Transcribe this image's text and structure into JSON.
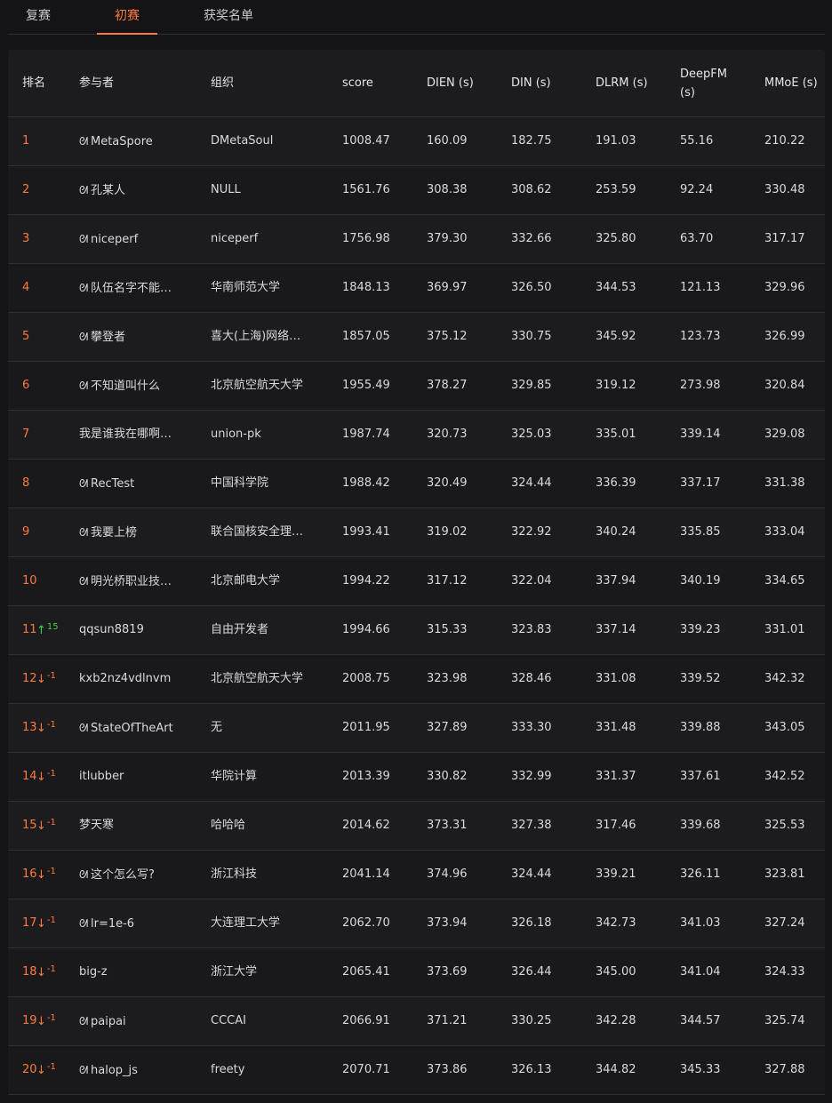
{
  "tabs": [
    {
      "label": "复赛",
      "active": false
    },
    {
      "label": "初赛",
      "active": true
    },
    {
      "label": "获奖名单",
      "active": false
    }
  ],
  "columns": [
    "排名",
    "参与者",
    "组织",
    "score",
    "DIEN (s)",
    "DIN (s)",
    "DLRM (s)",
    "DeepFM (s)",
    "MMoE (s)"
  ],
  "rows": [
    {
      "rank": "1",
      "change": null,
      "participant": "MetaSpore",
      "team": true,
      "org": "DMetaSoul",
      "score": "1008.47",
      "dien": "160.09",
      "din": "182.75",
      "dlrm": "191.03",
      "deepfm": "55.16",
      "mmoe": "210.22"
    },
    {
      "rank": "2",
      "change": null,
      "participant": "孔某人",
      "team": true,
      "org": "NULL",
      "score": "1561.76",
      "dien": "308.38",
      "din": "308.62",
      "dlrm": "253.59",
      "deepfm": "92.24",
      "mmoe": "330.48"
    },
    {
      "rank": "3",
      "change": null,
      "participant": "niceperf",
      "team": true,
      "org": "niceperf",
      "score": "1756.98",
      "dien": "379.30",
      "din": "332.66",
      "dlrm": "325.80",
      "deepfm": "63.70",
      "mmoe": "317.17"
    },
    {
      "rank": "4",
      "change": null,
      "participant": "队伍名字不能…",
      "team": true,
      "org": "华南师范大学",
      "score": "1848.13",
      "dien": "369.97",
      "din": "326.50",
      "dlrm": "344.53",
      "deepfm": "121.13",
      "mmoe": "329.96"
    },
    {
      "rank": "5",
      "change": null,
      "participant": "攀登者",
      "team": true,
      "org": "喜大(上海)网络…",
      "score": "1857.05",
      "dien": "375.12",
      "din": "330.75",
      "dlrm": "345.92",
      "deepfm": "123.73",
      "mmoe": "326.99"
    },
    {
      "rank": "6",
      "change": null,
      "participant": "不知道叫什么",
      "team": true,
      "org": "北京航空航天大学",
      "score": "1955.49",
      "dien": "378.27",
      "din": "329.85",
      "dlrm": "319.12",
      "deepfm": "273.98",
      "mmoe": "320.84"
    },
    {
      "rank": "7",
      "change": null,
      "participant": "我是谁我在哪啊…",
      "team": false,
      "org": "union-pk",
      "score": "1987.74",
      "dien": "320.73",
      "din": "325.03",
      "dlrm": "335.01",
      "deepfm": "339.14",
      "mmoe": "329.08"
    },
    {
      "rank": "8",
      "change": null,
      "participant": "RecTest",
      "team": true,
      "org": "中国科学院",
      "score": "1988.42",
      "dien": "320.49",
      "din": "324.44",
      "dlrm": "336.39",
      "deepfm": "337.17",
      "mmoe": "331.38"
    },
    {
      "rank": "9",
      "change": null,
      "participant": "我要上榜",
      "team": true,
      "org": "联合国核安全理…",
      "score": "1993.41",
      "dien": "319.02",
      "din": "322.92",
      "dlrm": "340.24",
      "deepfm": "335.85",
      "mmoe": "333.04"
    },
    {
      "rank": "10",
      "change": null,
      "participant": "明光桥职业技…",
      "team": true,
      "org": "北京邮电大学",
      "score": "1994.22",
      "dien": "317.12",
      "din": "322.04",
      "dlrm": "337.94",
      "deepfm": "340.19",
      "mmoe": "334.65"
    },
    {
      "rank": "11",
      "change": {
        "dir": "up",
        "arrow": "↑",
        "value": "15"
      },
      "participant": "qqsun8819",
      "team": false,
      "org": "自由开发者",
      "score": "1994.66",
      "dien": "315.33",
      "din": "323.83",
      "dlrm": "337.14",
      "deepfm": "339.23",
      "mmoe": "331.01"
    },
    {
      "rank": "12",
      "change": {
        "dir": "down",
        "arrow": "↓",
        "value": "-1"
      },
      "participant": "kxb2nz4vdlnvm",
      "team": false,
      "org": "北京航空航天大学",
      "score": "2008.75",
      "dien": "323.98",
      "din": "328.46",
      "dlrm": "331.08",
      "deepfm": "339.52",
      "mmoe": "342.32"
    },
    {
      "rank": "13",
      "change": {
        "dir": "down",
        "arrow": "↓",
        "value": "-1"
      },
      "participant": "StateOfTheArt",
      "team": true,
      "org": "无",
      "score": "2011.95",
      "dien": "327.89",
      "din": "333.30",
      "dlrm": "331.48",
      "deepfm": "339.88",
      "mmoe": "343.05"
    },
    {
      "rank": "14",
      "change": {
        "dir": "down",
        "arrow": "↓",
        "value": "-1"
      },
      "participant": "itlubber",
      "team": false,
      "org": "华院计算",
      "score": "2013.39",
      "dien": "330.82",
      "din": "332.99",
      "dlrm": "331.37",
      "deepfm": "337.61",
      "mmoe": "342.52"
    },
    {
      "rank": "15",
      "change": {
        "dir": "down",
        "arrow": "↓",
        "value": "-1"
      },
      "participant": "梦天寒",
      "team": false,
      "org": "哈哈哈",
      "score": "2014.62",
      "dien": "373.31",
      "din": "327.38",
      "dlrm": "317.46",
      "deepfm": "339.68",
      "mmoe": "325.53"
    },
    {
      "rank": "16",
      "change": {
        "dir": "down",
        "arrow": "↓",
        "value": "-1"
      },
      "participant": "这个怎么写?",
      "team": true,
      "org": "浙江科技",
      "score": "2041.14",
      "dien": "374.96",
      "din": "324.44",
      "dlrm": "339.21",
      "deepfm": "326.11",
      "mmoe": "323.81"
    },
    {
      "rank": "17",
      "change": {
        "dir": "down",
        "arrow": "↓",
        "value": "-1"
      },
      "participant": "lr=1e-6",
      "team": true,
      "org": "大连理工大学",
      "score": "2062.70",
      "dien": "373.94",
      "din": "326.18",
      "dlrm": "342.73",
      "deepfm": "341.03",
      "mmoe": "327.24"
    },
    {
      "rank": "18",
      "change": {
        "dir": "down",
        "arrow": "↓",
        "value": "-1"
      },
      "participant": "big-z",
      "team": false,
      "org": "浙江大学",
      "score": "2065.41",
      "dien": "373.69",
      "din": "326.44",
      "dlrm": "345.00",
      "deepfm": "341.04",
      "mmoe": "324.33"
    },
    {
      "rank": "19",
      "change": {
        "dir": "down",
        "arrow": "↓",
        "value": "-1"
      },
      "participant": "paipai",
      "team": true,
      "org": "CCCAI",
      "score": "2066.91",
      "dien": "371.21",
      "din": "330.25",
      "dlrm": "342.28",
      "deepfm": "344.57",
      "mmoe": "325.74"
    },
    {
      "rank": "20",
      "change": {
        "dir": "down",
        "arrow": "↓",
        "value": "-1"
      },
      "participant": "halop_js",
      "team": true,
      "org": "freety",
      "score": "2070.71",
      "dien": "373.86",
      "din": "326.13",
      "dlrm": "344.82",
      "deepfm": "345.33",
      "mmoe": "327.88"
    }
  ],
  "team_icon": "ᘛ",
  "accent_color": "#ff7a3d",
  "up_color": "#3fcf4e"
}
